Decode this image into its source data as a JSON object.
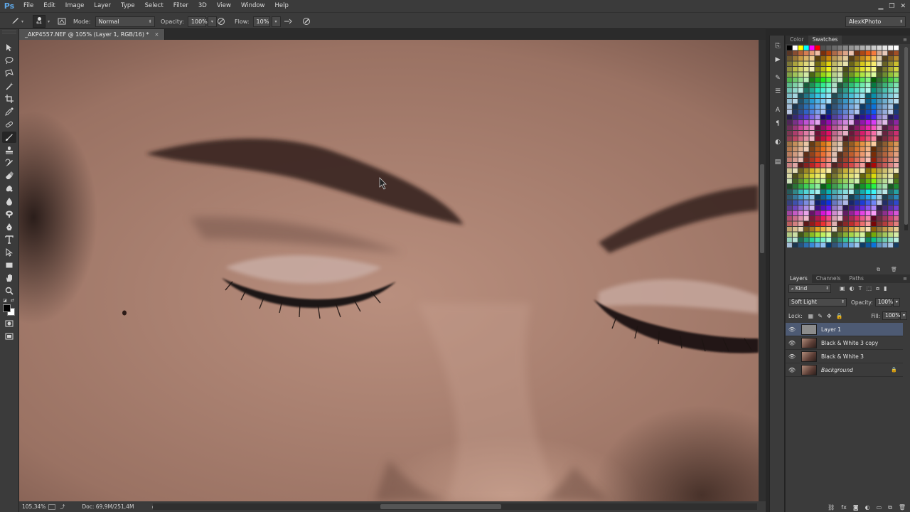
{
  "app": {
    "logo": "Ps"
  },
  "menu": [
    "File",
    "Edit",
    "Image",
    "Layer",
    "Type",
    "Select",
    "Filter",
    "3D",
    "View",
    "Window",
    "Help"
  ],
  "window_controls": {
    "minimize": "▁",
    "restore": "❐",
    "close": "✕"
  },
  "options": {
    "brush_size": "64",
    "mode_label": "Mode:",
    "mode_value": "Normal",
    "opacity_label": "Opacity:",
    "opacity_value": "100%",
    "flow_label": "Flow:",
    "flow_value": "10%",
    "workspace": "AlexKPhoto"
  },
  "document": {
    "tab_title": "_AKP4557.NEF @ 105% (Layer 1, RGB/16) *",
    "close_glyph": "✕"
  },
  "status": {
    "zoom": "105,34%",
    "doc_info": "Doc: 69,9M/251,4M",
    "arrow": "▸"
  },
  "swatches_panel": {
    "tabs": [
      "Color",
      "Swatches"
    ],
    "active_tab": "Swatches"
  },
  "layers_panel": {
    "tabs": [
      "Layers",
      "Channels",
      "Paths"
    ],
    "active_tab": "Layers",
    "filter_kind": "Kind",
    "blend_mode": "Soft Light",
    "opacity_label": "Opacity:",
    "opacity_value": "100%",
    "lock_label": "Lock:",
    "fill_label": "Fill:",
    "fill_value": "100%",
    "layers": [
      {
        "name": "Layer 1",
        "selected": true
      },
      {
        "name": "Black & White 3 copy",
        "selected": false
      },
      {
        "name": "Black & White 3",
        "selected": false
      },
      {
        "name": "Background",
        "selected": false,
        "locked": true
      }
    ]
  },
  "colors": {
    "accent": "#4d5a73",
    "chrome": "#3b3b3b",
    "ps_blue": "#5fa8e8"
  },
  "icons": {
    "toolbar": [
      "move-icon",
      "lasso-icon",
      "polygon-lasso-icon",
      "magic-wand-icon",
      "crop-icon",
      "eyedropper-icon",
      "spot-heal-icon",
      "brush-icon",
      "clone-stamp-icon",
      "history-brush-icon",
      "eraser-icon",
      "gradient-icon",
      "blur-icon",
      "dodge-icon",
      "pen-icon",
      "type-icon",
      "path-select-icon",
      "rectangle-icon",
      "hand-icon",
      "zoom-icon"
    ]
  }
}
